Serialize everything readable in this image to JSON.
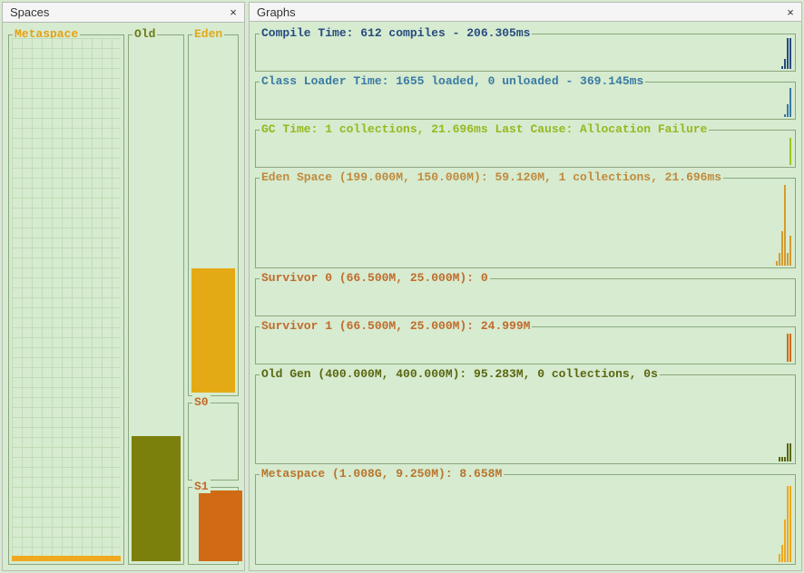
{
  "panels": {
    "spaces_title": "Spaces",
    "graphs_title": "Graphs",
    "close_glyph": "×"
  },
  "spaces": {
    "metaspace_label": "Metaspace",
    "old_label": "Old",
    "eden_label": "Eden",
    "s0_label": "S0",
    "s1_label": "S1"
  },
  "graphs": {
    "compile": "Compile Time: 612 compiles - 206.305ms",
    "loader": "Class Loader Time: 1655 loaded, 0 unloaded - 369.145ms",
    "gc": "GC Time: 1 collections, 21.696ms Last Cause: Allocation Failure",
    "eden": "Eden Space (199.000M, 150.000M): 59.120M, 1 collections, 21.696ms",
    "s0": "Survivor 0 (66.500M, 25.000M): 0",
    "s1": "Survivor 1 (66.500M, 25.000M): 24.999M",
    "oldgen": "Old Gen (400.000M, 400.000M): 95.283M, 0 collections, 0s",
    "metaspace": "Metaspace (1.008G, 9.250M): 8.658M"
  },
  "chart_data": [
    {
      "type": "bar",
      "name": "Metaspace usage",
      "capacity": "1.008G",
      "committed": "9.250M",
      "used": "8.658M"
    },
    {
      "type": "bar",
      "name": "Old Gen usage",
      "capacity": "400.000M",
      "committed": "400.000M",
      "used": "95.283M",
      "fill_pct": 24
    },
    {
      "type": "bar",
      "name": "Eden usage",
      "capacity": "199.000M",
      "committed": "150.000M",
      "used": "59.120M",
      "fill_pct": 39
    },
    {
      "type": "bar",
      "name": "Survivor 0",
      "capacity": "66.500M",
      "committed": "25.000M",
      "used": "0",
      "fill_pct": 0
    },
    {
      "type": "bar",
      "name": "Survivor 1",
      "capacity": "66.500M",
      "committed": "25.000M",
      "used": "24.999M",
      "fill_pct": 100
    },
    {
      "type": "line",
      "name": "Compile Time",
      "compiles": 612,
      "time_ms": 206.305
    },
    {
      "type": "line",
      "name": "Class Loader Time",
      "loaded": 1655,
      "unloaded": 0,
      "time_ms": 369.145
    },
    {
      "type": "line",
      "name": "GC Time",
      "collections": 1,
      "time_ms": 21.696,
      "last_cause": "Allocation Failure"
    }
  ]
}
